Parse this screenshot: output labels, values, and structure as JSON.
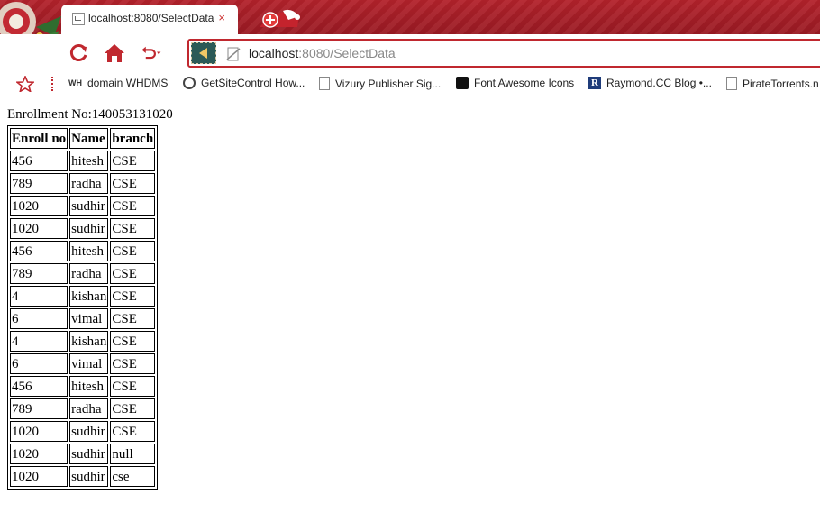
{
  "browser": {
    "tab": {
      "title": "localhost:8080/SelectData",
      "close": "×"
    },
    "address": {
      "host": "localhost",
      "rest": ":8080/SelectData"
    },
    "bookmarks": [
      {
        "label": "domain WHDMS",
        "icon": "wh-icon",
        "badge": "WH"
      },
      {
        "label": "GetSiteControl How...",
        "icon": "site-icon"
      },
      {
        "label": "Vizury Publisher Sig...",
        "icon": "page-icon"
      },
      {
        "label": "Font Awesome Icons",
        "icon": "flag-icon"
      },
      {
        "label": "Raymond.CC Blog •...",
        "icon": "r-icon"
      },
      {
        "label": "PirateTorrents.n",
        "icon": "page-icon"
      }
    ]
  },
  "page": {
    "enrollment_line": "Enrollment No:140053131020",
    "table": {
      "headers": [
        "Enroll no",
        "Name",
        "branch"
      ],
      "rows": [
        [
          "456",
          "hitesh",
          "CSE"
        ],
        [
          "789",
          "radha",
          "CSE"
        ],
        [
          "1020",
          "sudhir",
          "CSE"
        ],
        [
          "1020",
          "sudhir",
          "CSE"
        ],
        [
          "456",
          "hitesh",
          "CSE"
        ],
        [
          "789",
          "radha",
          "CSE"
        ],
        [
          "4",
          "kishan",
          "CSE"
        ],
        [
          "6",
          "vimal",
          "CSE"
        ],
        [
          "4",
          "kishan",
          "CSE"
        ],
        [
          "6",
          "vimal",
          "CSE"
        ],
        [
          "456",
          "hitesh",
          "CSE"
        ],
        [
          "789",
          "radha",
          "CSE"
        ],
        [
          "1020",
          "sudhir",
          "CSE"
        ],
        [
          "1020",
          "sudhir",
          "null"
        ],
        [
          "1020",
          "sudhir",
          "cse"
        ]
      ]
    }
  }
}
